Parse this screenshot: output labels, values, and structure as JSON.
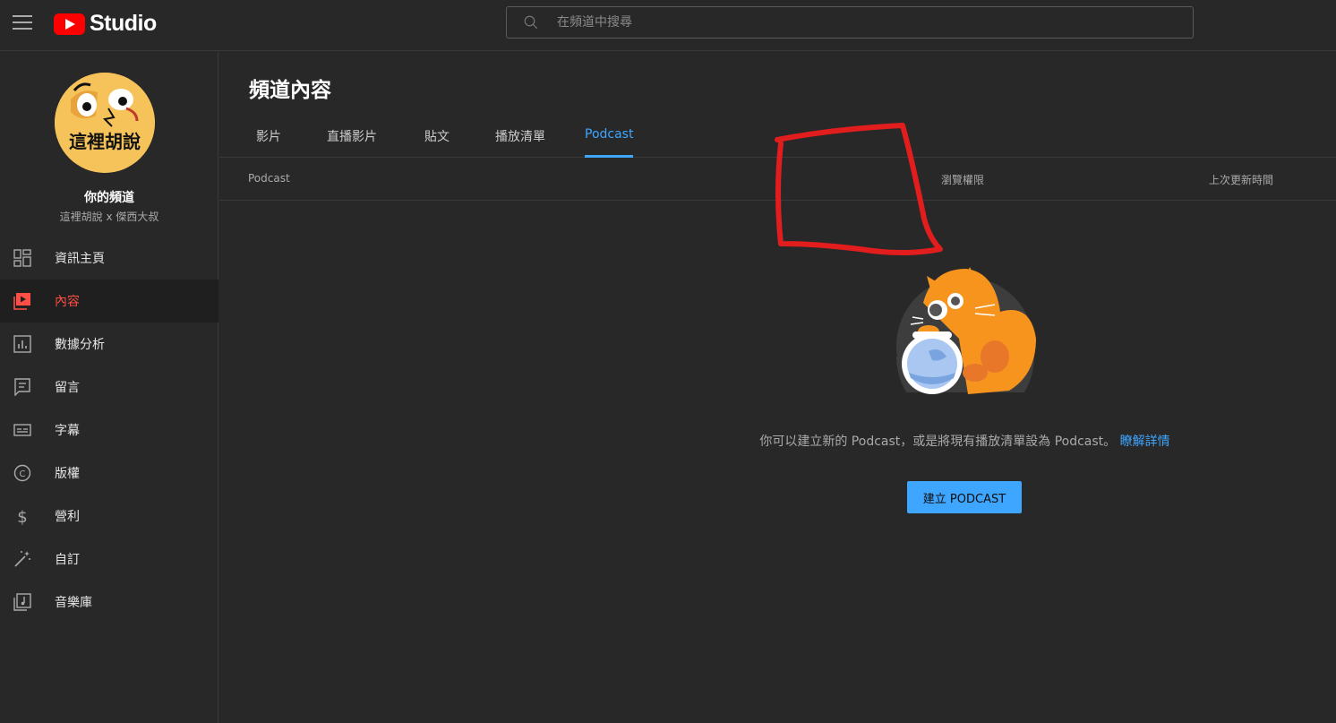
{
  "header": {
    "menu_icon": "hamburger-menu-icon",
    "logo_text": "Studio",
    "search": {
      "placeholder": "在頻道中搜尋",
      "icon": "search-icon"
    }
  },
  "sidebar": {
    "channel_name": "你的頻道",
    "channel_subtitle": "這裡胡說 x 傑西大叔",
    "avatar_text": "這裡胡說",
    "items": [
      {
        "label": "資訊主頁",
        "icon": "dashboard-icon",
        "active": false
      },
      {
        "label": "內容",
        "icon": "content-icon",
        "active": true
      },
      {
        "label": "數據分析",
        "icon": "analytics-icon",
        "active": false
      },
      {
        "label": "留言",
        "icon": "comments-icon",
        "active": false
      },
      {
        "label": "字幕",
        "icon": "subtitles-icon",
        "active": false
      },
      {
        "label": "版權",
        "icon": "copyright-icon",
        "active": false
      },
      {
        "label": "營利",
        "icon": "monetization-icon",
        "active": false
      },
      {
        "label": "自訂",
        "icon": "customization-icon",
        "active": false
      },
      {
        "label": "音樂庫",
        "icon": "audio-library-icon",
        "active": false
      }
    ],
    "active_color": "#ff4e45"
  },
  "main": {
    "title": "頻道內容",
    "tabs": [
      {
        "label": "影片",
        "active": false
      },
      {
        "label": "直播影片",
        "active": false
      },
      {
        "label": "貼文",
        "active": false
      },
      {
        "label": "播放清單",
        "active": false
      },
      {
        "label": "Podcast",
        "active": true
      }
    ],
    "columns": {
      "podcast": "Podcast",
      "visibility": "瀏覽權限",
      "last_updated": "上次更新時間"
    },
    "empty_state": {
      "message": "你可以建立新的 Podcast，或是將現有播放清單設為 Podcast。",
      "learn_more": "瞭解詳情",
      "button": "建立 PODCAST"
    },
    "accent_color": "#3ea6ff"
  }
}
